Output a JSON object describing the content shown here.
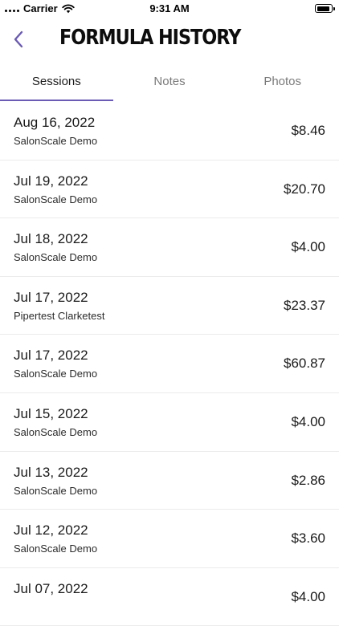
{
  "status_bar": {
    "carrier": "Carrier",
    "time": "9:31 AM"
  },
  "header": {
    "title": "FORMULA HISTORY",
    "back_icon": "chevron-left-icon",
    "accent_color": "#6b5bb5"
  },
  "tabs": [
    {
      "label": "Sessions",
      "active": true
    },
    {
      "label": "Notes",
      "active": false
    },
    {
      "label": "Photos",
      "active": false
    }
  ],
  "sessions": [
    {
      "date": "Aug 16, 2022",
      "client": "SalonScale Demo",
      "amount": "$8.46"
    },
    {
      "date": "Jul 19, 2022",
      "client": "SalonScale Demo",
      "amount": "$20.70"
    },
    {
      "date": "Jul 18, 2022",
      "client": "SalonScale Demo",
      "amount": "$4.00"
    },
    {
      "date": "Jul 17, 2022",
      "client": "Pipertest Clarketest",
      "amount": "$23.37"
    },
    {
      "date": "Jul 17, 2022",
      "client": "SalonScale Demo",
      "amount": "$60.87"
    },
    {
      "date": "Jul 15, 2022",
      "client": "SalonScale Demo",
      "amount": "$4.00"
    },
    {
      "date": "Jul 13, 2022",
      "client": "SalonScale Demo",
      "amount": "$2.86"
    },
    {
      "date": "Jul 12, 2022",
      "client": "SalonScale Demo",
      "amount": "$3.60"
    },
    {
      "date": "Jul 07, 2022",
      "client": "",
      "amount": "$4.00"
    }
  ]
}
